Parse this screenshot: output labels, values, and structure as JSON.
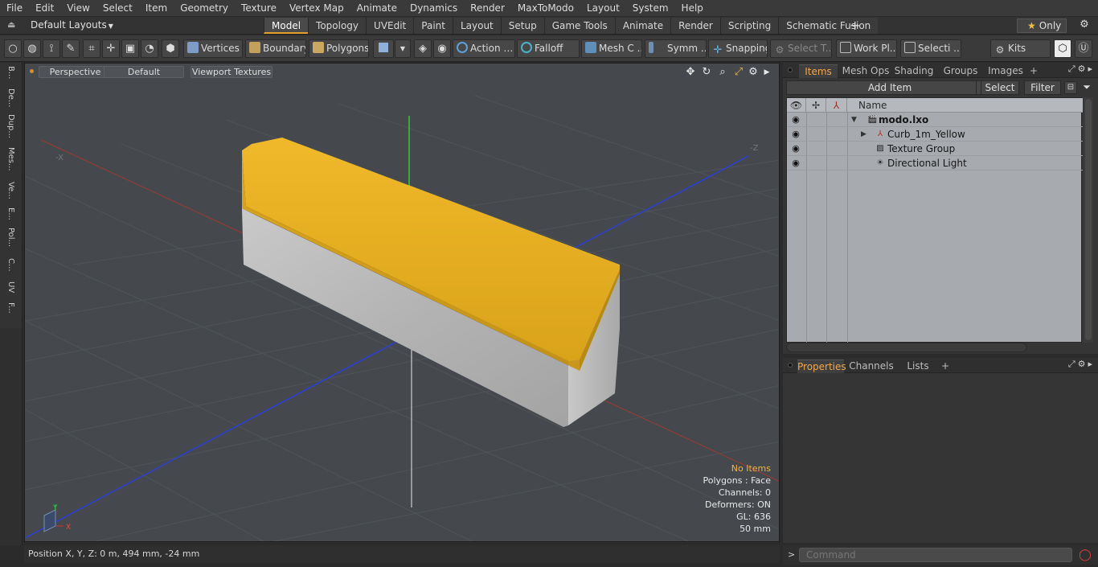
{
  "menu": [
    "File",
    "Edit",
    "View",
    "Select",
    "Item",
    "Geometry",
    "Texture",
    "Vertex Map",
    "Animate",
    "Dynamics",
    "Render",
    "MaxToModo",
    "Layout",
    "System",
    "Help"
  ],
  "layout": {
    "label": "Default Layouts",
    "tabs": [
      "Model",
      "Topology",
      "UVEdit",
      "Paint",
      "Layout",
      "Setup",
      "Game Tools",
      "Animate",
      "Render",
      "Scripting",
      "Schematic Fusion"
    ],
    "active_tab": "Model",
    "only_label": "Only"
  },
  "toolbar": {
    "vertices": "Vertices",
    "boundary": "Boundary",
    "polygons": "Polygons",
    "action": "Action",
    "falloff": "Falloff",
    "mesh": "Mesh C ...",
    "symmetry": "Symm ...",
    "snapping": "Snapping",
    "select_tool": "Select T...",
    "workplane": "Work Pl...",
    "selection": "Selecti ...",
    "kits": "Kits"
  },
  "left_tabs": [
    "B...",
    "De...",
    "Dup...",
    "Mes...",
    "Ve...",
    "E...",
    "Pol...",
    "C...",
    "UV",
    "F..."
  ],
  "viewport": {
    "view": "Perspective",
    "shading": "Default",
    "textures": "Viewport Textures",
    "hud": {
      "items": "No Items",
      "polygons": "Polygons : Face",
      "channels": "Channels: 0",
      "deformers": "Deformers: ON",
      "gl": "GL: 636",
      "scale": "50 mm"
    },
    "axis_labels": {
      "x": "X",
      "y": "Y",
      "minus_x": "-X",
      "minus_z": "-Z"
    },
    "colors": {
      "curb_top": "#e0a81c",
      "curb_body": "#b8b8b8",
      "background": "#45494d",
      "x_axis": "#c0392b",
      "z_axis": "#2c3fd6",
      "y_axis": "#2ecc40"
    }
  },
  "status": {
    "position": "Position X, Y, Z:   0 m, 494 mm, -24 mm"
  },
  "items_panel": {
    "tabs": [
      "Items",
      "Mesh Ops",
      "Shading",
      "Groups",
      "Images"
    ],
    "active_tab": "Items",
    "add_item": "Add Item",
    "select": "Select",
    "filter": "Filter",
    "column_name": "Name",
    "tree": [
      {
        "label": "modo.lxo",
        "icon": "scene-icon",
        "indent": 0,
        "bold": true,
        "expanded": true
      },
      {
        "label": "Curb_1m_Yellow",
        "icon": "mesh-locator-icon",
        "indent": 1,
        "bold": false,
        "collapsed": true
      },
      {
        "label": "Texture Group",
        "icon": "texture-group-icon",
        "indent": 1,
        "bold": false
      },
      {
        "label": "Directional Light",
        "icon": "light-icon",
        "indent": 1,
        "bold": false
      }
    ]
  },
  "properties_panel": {
    "tabs": [
      "Properties",
      "Channels",
      "Lists"
    ],
    "active_tab": "Properties"
  },
  "command": {
    "placeholder": "Command"
  }
}
